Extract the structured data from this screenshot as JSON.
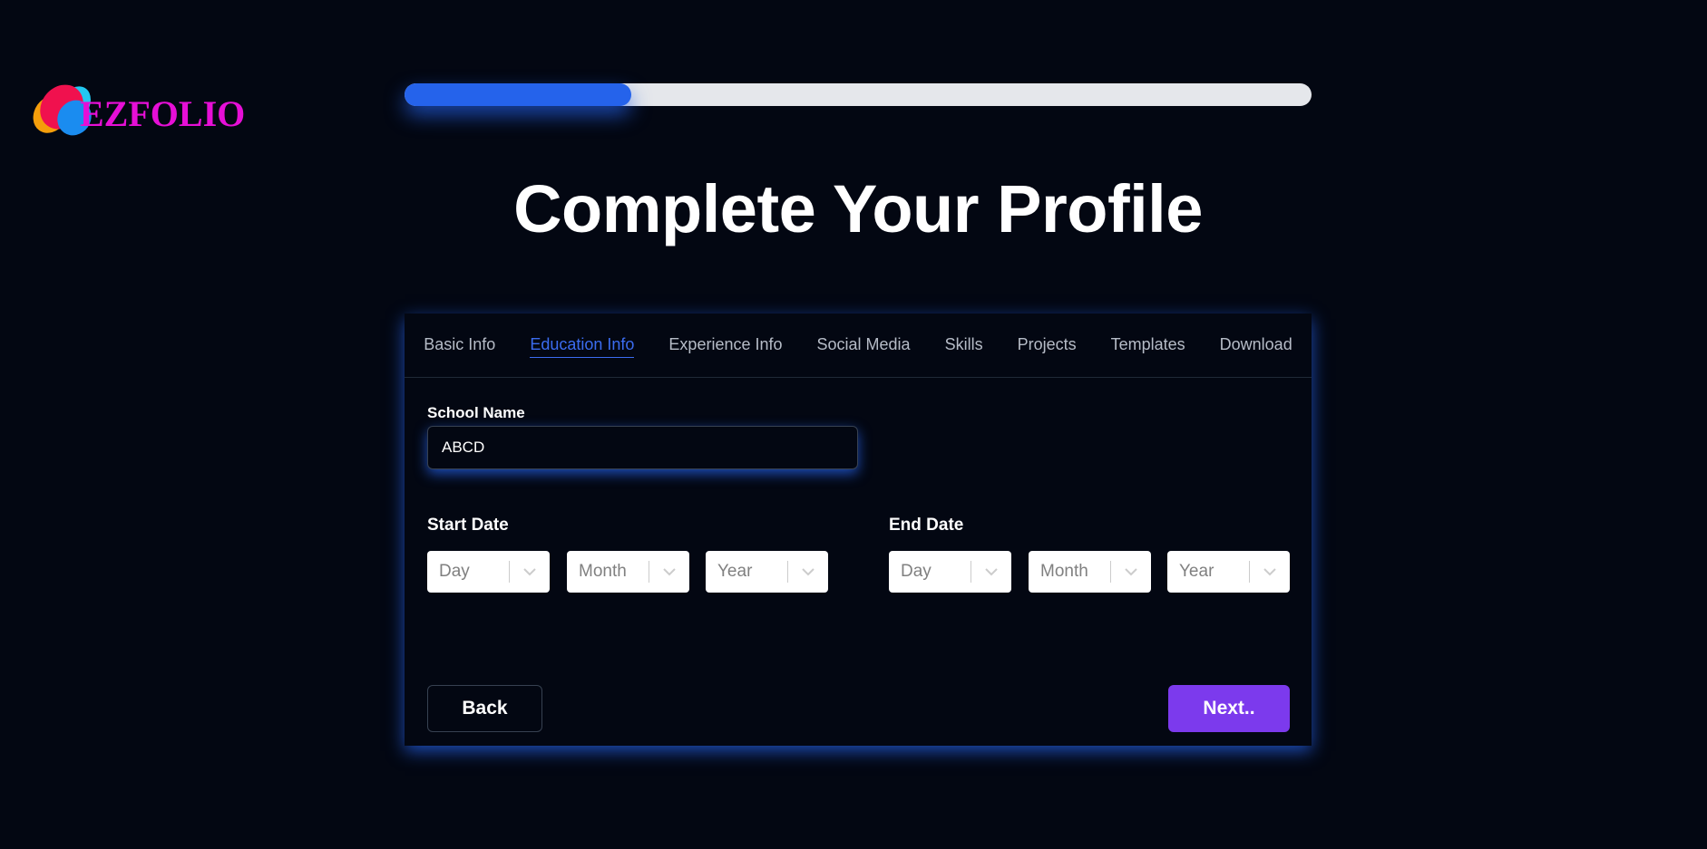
{
  "logo": {
    "text": "EZFOLIO"
  },
  "progress": {
    "value": 0.25
  },
  "page_title": "Complete Your Profile",
  "tabs": [
    {
      "label": "Basic Info",
      "active": false
    },
    {
      "label": "Education Info",
      "active": true
    },
    {
      "label": "Experience Info",
      "active": false
    },
    {
      "label": "Social Media",
      "active": false
    },
    {
      "label": "Skills",
      "active": false
    },
    {
      "label": "Projects",
      "active": false
    },
    {
      "label": "Templates",
      "active": false
    },
    {
      "label": "Download",
      "active": false
    }
  ],
  "form": {
    "school_name": {
      "label": "School Name",
      "value": "ABCD"
    },
    "start_date": {
      "label": "Start Date",
      "day": "Day",
      "month": "Month",
      "year": "Year"
    },
    "end_date": {
      "label": "End Date",
      "day": "Day",
      "month": "Month",
      "year": "Year"
    }
  },
  "buttons": {
    "back": "Back",
    "next": "Next.."
  },
  "colors": {
    "background": "#030712",
    "accent": "#2563eb",
    "active_tab": "#3b6cf0",
    "next_button": "#7c3aed",
    "logo_text": "#e60fd6"
  }
}
